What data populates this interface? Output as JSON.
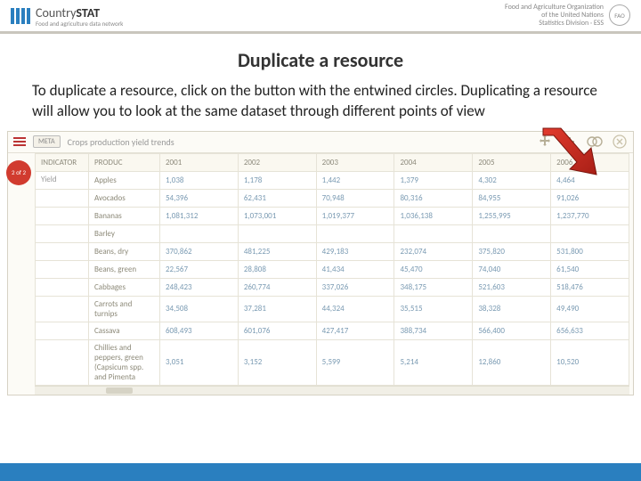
{
  "header": {
    "brand_main": "Country",
    "brand_accent": "STAT",
    "brand_sub": "Food and agriculture data network",
    "org_line1": "Food and Agriculture Organization",
    "org_line2": "of the United Nations",
    "org_line3": "Statistics Division · ESS",
    "fao": "FAO"
  },
  "slide": {
    "title": "Duplicate a resource",
    "body": "To duplicate a resource, click on the button with the entwined circles. Duplicating a resource will allow you to look at the same dataset through different points of view"
  },
  "app": {
    "meta_label": "META",
    "title": "Crops production yield trends",
    "badge": "2 of 2"
  },
  "table": {
    "headers": [
      "INDICATOR",
      "PRODUC",
      "2001",
      "2002",
      "2003",
      "2004",
      "2005",
      "2006"
    ],
    "indicator": "Yield",
    "rows": [
      {
        "product": "Apples",
        "v": [
          "1,038",
          "1,178",
          "1,442",
          "1,379",
          "4,302",
          "4,464"
        ]
      },
      {
        "product": "Avocados",
        "v": [
          "54,396",
          "62,431",
          "70,948",
          "80,316",
          "84,955",
          "91,026"
        ]
      },
      {
        "product": "Bananas",
        "v": [
          "1,081,312",
          "1,073,001",
          "1,019,377",
          "1,036,138",
          "1,255,995",
          "1,237,770"
        ]
      },
      {
        "product": "Barley",
        "v": [
          "",
          "",
          "",
          "",
          "",
          ""
        ]
      },
      {
        "product": "Beans, dry",
        "v": [
          "370,862",
          "481,225",
          "429,183",
          "232,074",
          "375,820",
          "531,800"
        ]
      },
      {
        "product": "Beans, green",
        "v": [
          "22,567",
          "28,808",
          "41,434",
          "45,470",
          "74,040",
          "61,540"
        ]
      },
      {
        "product": "Cabbages",
        "v": [
          "248,423",
          "260,774",
          "337,026",
          "348,175",
          "521,603",
          "518,476"
        ]
      },
      {
        "product": "Carrots and turnips",
        "v": [
          "34,508",
          "37,281",
          "44,324",
          "35,515",
          "38,328",
          "49,490"
        ]
      },
      {
        "product": "Cassava",
        "v": [
          "608,493",
          "601,076",
          "427,417",
          "388,734",
          "566,400",
          "656,633"
        ]
      },
      {
        "product": "Chillies and peppers, green (Capsicum spp. and Pimenta",
        "v": [
          "3,051",
          "3,152",
          "5,599",
          "5,214",
          "12,860",
          "10,520"
        ]
      }
    ]
  }
}
